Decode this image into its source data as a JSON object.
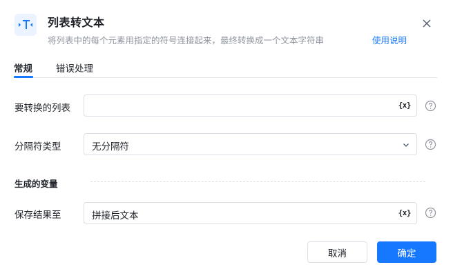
{
  "header": {
    "title": "列表转文本",
    "subtitle": "将列表中的每个元素用指定的符号连接起来，最终转换成一个文本字符串",
    "help_link": "使用说明",
    "app_icon": "text-convert-icon",
    "close_icon": "close-icon"
  },
  "tabs": [
    {
      "label": "常规",
      "active": true
    },
    {
      "label": "错误处理",
      "active": false
    }
  ],
  "fields": {
    "list_to_convert": {
      "label": "要转换的列表",
      "value": "",
      "icon": "{x}"
    },
    "separator_type": {
      "label": "分隔符类型",
      "value": "无分隔符"
    },
    "section_output": {
      "label": "生成的变量"
    },
    "save_result_to": {
      "label": "保存结果至",
      "value": "拼接后文本",
      "icon": "{x}"
    }
  },
  "footer": {
    "cancel_label": "取消",
    "confirm_label": "确定"
  },
  "colors": {
    "accent": "#1677ff",
    "muted_text": "#8f959e",
    "border": "#dcdfe6"
  }
}
